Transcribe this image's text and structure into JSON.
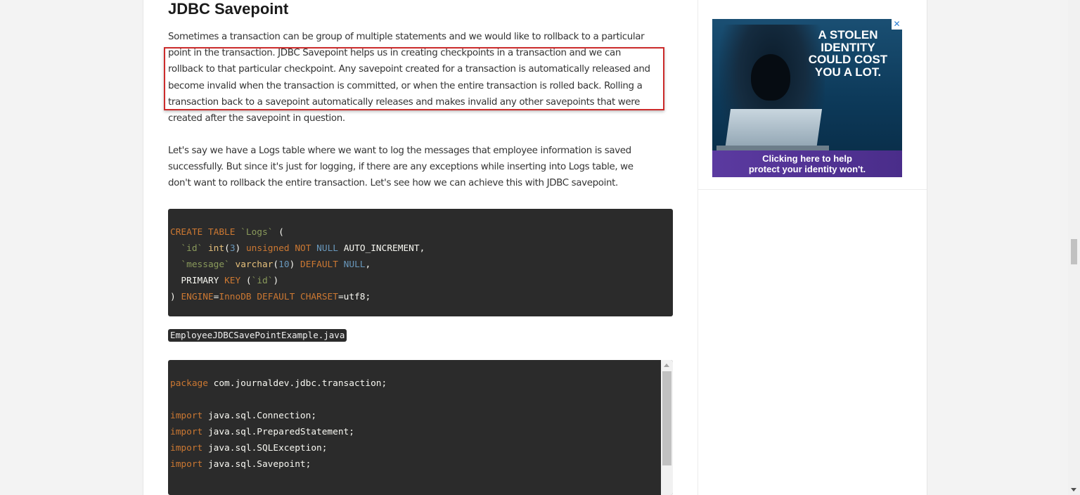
{
  "article": {
    "title": "JDBC Savepoint",
    "para1": [
      "Sometimes a transaction can be group of multiple statements and we would like to rollback to a particular",
      "point in the transaction. JDBC Savepoint helps us in creating checkpoints in a transaction and we can",
      "rollback to that particular checkpoint. Any savepoint created for a transaction is automatically released and",
      "become invalid when the transaction is committed, or when the entire transaction is rolled back. Rolling a",
      "transaction back to a savepoint automatically releases and makes invalid any other savepoints that were",
      "created after the savepoint in question."
    ],
    "para2": [
      "Let's say we have a Logs table where we want to log the messages that employee information is saved",
      "successfully. But since it's just for logging, if there are any exceptions while inserting into Logs table, we",
      "don't want to rollback the entire transaction. Let's see how we can achieve this with JDBC savepoint."
    ],
    "sql_code": {
      "l1_create": "CREATE TABLE",
      "l1_name": "`Logs`",
      "l1_paren": " (",
      "l2_col": "`id`",
      "l2_type": "int",
      "l2_open": "(",
      "l2_num": "3",
      "l2_close": ")",
      "l2_unsigned": "unsigned",
      "l2_notnull": "NOT",
      "l2_null": "NULL",
      "l2_auto": " AUTO_INCREMENT,",
      "l3_col": "`message`",
      "l3_type": "varchar",
      "l3_open": "(",
      "l3_num": "10",
      "l3_close": ")",
      "l3_default": "DEFAULT",
      "l3_null": "NULL",
      "l3_comma": ",",
      "l4_primary": "PRIMARY",
      "l4_key": "KEY",
      "l4_open": " (",
      "l4_col": "`id`",
      "l4_close": ")",
      "l5_paren": ")",
      "l5_engine": "ENGINE",
      "l5_eq": "=",
      "l5_innodb": "InnoDB",
      "l5_default": "DEFAULT",
      "l5_charset": "CHARSET",
      "l5_utf": "=utf8;"
    },
    "filename": "EmployeeJDBCSavePointExample.java",
    "java_code": {
      "package_kw": "package",
      "package_name": " com.journaldev.jdbc.transaction;",
      "imports": [
        {
          "kw": "import",
          "name": " java.sql.Connection;"
        },
        {
          "kw": "import",
          "name": " java.sql.PreparedStatement;"
        },
        {
          "kw": "import",
          "name": " java.sql.SQLException;"
        },
        {
          "kw": "import",
          "name": " java.sql.Savepoint;"
        }
      ]
    }
  },
  "ad": {
    "headline": [
      "A STOLEN",
      "IDENTITY",
      "COULD COST",
      "YOU A LOT."
    ],
    "footer": [
      "Clicking here to help",
      "protect your identity won't."
    ],
    "close": "✕"
  },
  "colors": {
    "highlight_border": "#cc2b2b",
    "code_bg": "#2b2b2b",
    "keyword": "#cc7832",
    "string": "#8a9a5b",
    "number": "#6897bb"
  }
}
